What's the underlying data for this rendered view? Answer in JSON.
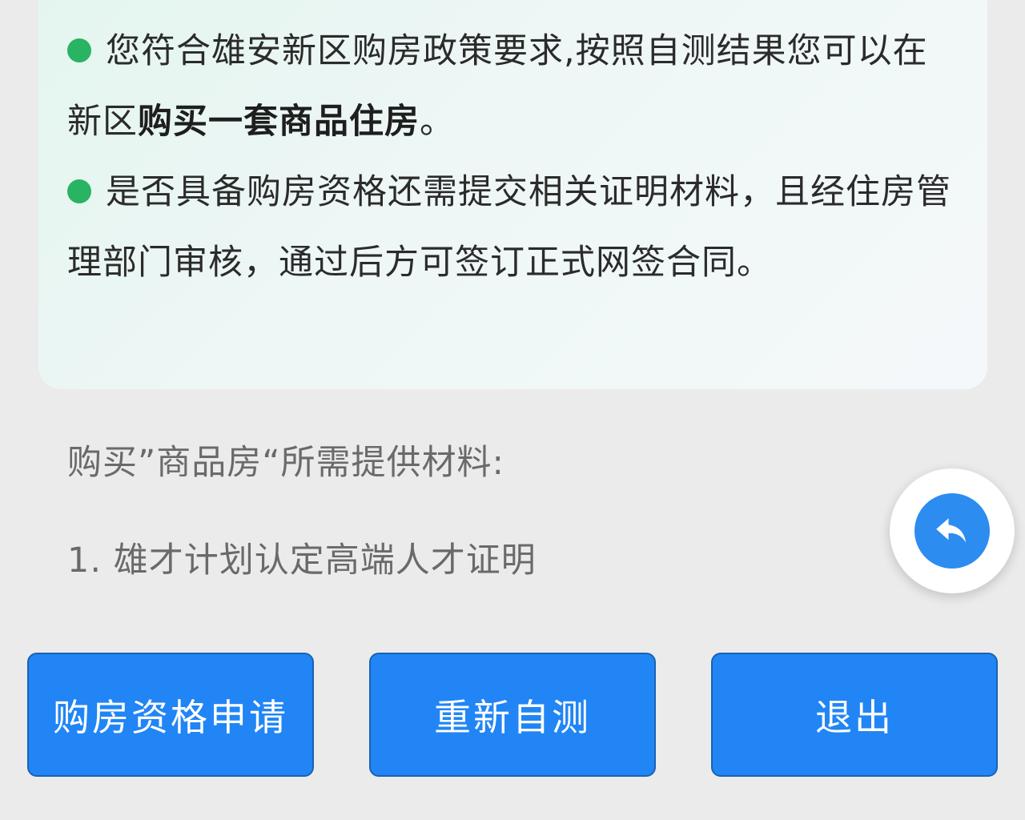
{
  "result_card": {
    "notice1_pre": "您符合雄安新区购房政策要求,按照自测结果您可以在新区",
    "notice1_bold": "购买一套商品住房",
    "notice1_post": "。",
    "notice2": "是否具备购房资格还需提交相关证明材料，且经住房管理部门审核，通过后方可签订正式网签合同。"
  },
  "materials": {
    "title": "购买”商品房“所需提供材料:",
    "items": [
      "1. 雄才计划认定高端人才证明"
    ]
  },
  "float_button": {
    "icon": "undo-arrow-icon"
  },
  "buttons": {
    "apply": "购房资格申请",
    "retest": "重新自测",
    "exit": "退出"
  },
  "colors": {
    "bullet": "#28b463",
    "primary": "#2185f5",
    "float_icon_bg": "#2c8cf0",
    "page_bg": "#ebebeb"
  }
}
